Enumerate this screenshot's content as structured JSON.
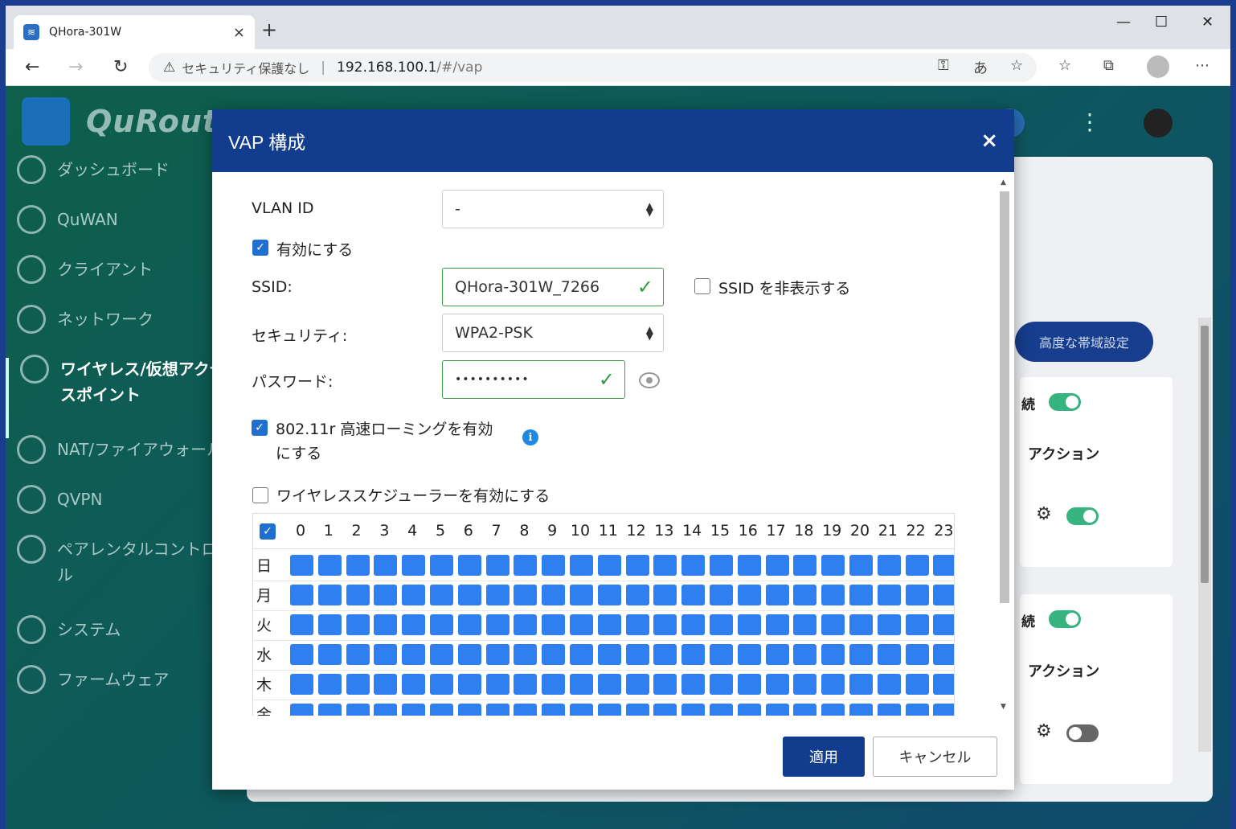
{
  "browser": {
    "tab_title": "QHora-301W",
    "tab_close": "×",
    "new_tab": "+",
    "window_min": "—",
    "window_max": "☐",
    "window_close": "✕",
    "security_warning": "セキュリティ保護なし",
    "url_host": "192.168.100.1",
    "url_path": "/#/vap"
  },
  "app": {
    "logo_text": "QuRout",
    "sidebar": {
      "items": [
        {
          "label": "ダッシュボード",
          "icon": "dashboard-icon"
        },
        {
          "label": "QuWAN",
          "icon": "quwan-icon"
        },
        {
          "label": "クライアント",
          "icon": "client-icon"
        },
        {
          "label": "ネットワーク",
          "icon": "network-icon"
        },
        {
          "label": "ワイヤレス/仮想アクセ",
          "label2": "スポイント",
          "icon": "wireless-icon",
          "active": true
        },
        {
          "label": "NAT/ファイアウォール",
          "icon": "firewall-icon"
        },
        {
          "label": "QVPN",
          "icon": "vpn-icon"
        },
        {
          "label": "ペアレンタルコントロ",
          "label2": "ル",
          "icon": "parental-control-icon"
        },
        {
          "label": "システム",
          "icon": "system-icon"
        },
        {
          "label": "ファームウェア",
          "icon": "firmware-icon"
        }
      ]
    },
    "background": {
      "advanced_band_button": "高度な帯域設定",
      "card1_title": "続",
      "card1_action": "アクション",
      "card2_title": "続",
      "card2_action": "アクション"
    }
  },
  "modal": {
    "title": "VAP 構成",
    "close": "×",
    "vlan_label": "VLAN ID",
    "vlan_value": "-",
    "enable_label": "有効にする",
    "ssid_label": "SSID:",
    "ssid_value": "QHora-301W_7266",
    "hide_ssid_label": "SSID を非表示する",
    "security_label": "セキュリティ:",
    "security_value": "WPA2-PSK",
    "password_label": "パスワード:",
    "password_value": "••••••••••",
    "roaming_label_line1": "802.11r 高速ローミングを有効",
    "roaming_label_line2": "にする",
    "scheduler_label": "ワイヤレススケジューラーを有効にする",
    "schedule": {
      "hours": [
        "0",
        "1",
        "2",
        "3",
        "4",
        "5",
        "6",
        "7",
        "8",
        "9",
        "10",
        "11",
        "12",
        "13",
        "14",
        "15",
        "16",
        "17",
        "18",
        "19",
        "20",
        "21",
        "22",
        "23"
      ],
      "days": [
        "日",
        "月",
        "火",
        "水",
        "木",
        "金"
      ]
    },
    "apply_button": "適用",
    "cancel_button": "キャンセル"
  },
  "colors": {
    "modal_header": "#123d8f",
    "schedule_cell": "#2f7ff0",
    "valid_green": "#2e9d3e"
  }
}
